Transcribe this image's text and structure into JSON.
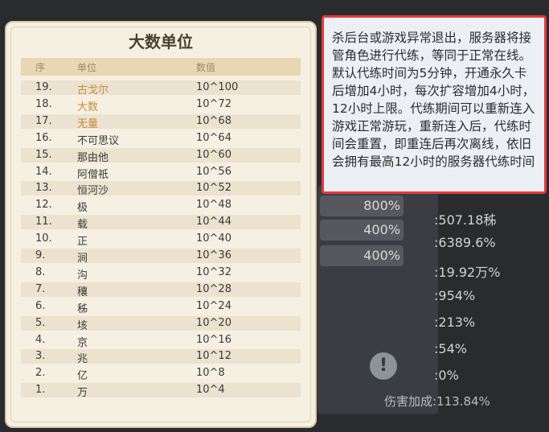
{
  "background": {
    "percents": [
      "800%",
      "400%",
      "400%"
    ],
    "stats": [
      ":507.18秭",
      ":6389.6%",
      ":19.92万%",
      ":954%",
      ":213%",
      ":54%",
      ":0%"
    ],
    "bottom_stat": "伤害加成:113.84%"
  },
  "units_table": {
    "title": "大数单位",
    "headers": {
      "idx": "序",
      "name": "单位",
      "value": "数值"
    },
    "rows": [
      {
        "idx": "19.",
        "name": "古戈尔",
        "value": "10^100",
        "highlight": true
      },
      {
        "idx": "18.",
        "name": "大数",
        "value": "10^72",
        "highlight": true
      },
      {
        "idx": "17.",
        "name": "无量",
        "value": "10^68",
        "highlight": true
      },
      {
        "idx": "16.",
        "name": "不可思议",
        "value": "10^64",
        "highlight": false
      },
      {
        "idx": "15.",
        "name": "那由他",
        "value": "10^60",
        "highlight": false
      },
      {
        "idx": "14.",
        "name": "阿僧祇",
        "value": "10^56",
        "highlight": false
      },
      {
        "idx": "13.",
        "name": "恒河沙",
        "value": "10^52",
        "highlight": false
      },
      {
        "idx": "12.",
        "name": "极",
        "value": "10^48",
        "highlight": false
      },
      {
        "idx": "11.",
        "name": "载",
        "value": "10^44",
        "highlight": false
      },
      {
        "idx": "10.",
        "name": "正",
        "value": "10^40",
        "highlight": false
      },
      {
        "idx": "9.",
        "name": "涧",
        "value": "10^36",
        "highlight": false
      },
      {
        "idx": "8.",
        "name": "沟",
        "value": "10^32",
        "highlight": false
      },
      {
        "idx": "7.",
        "name": "穰",
        "value": "10^28",
        "highlight": false
      },
      {
        "idx": "6.",
        "name": "秭",
        "value": "10^24",
        "highlight": false
      },
      {
        "idx": "5.",
        "name": "垓",
        "value": "10^20",
        "highlight": false
      },
      {
        "idx": "4.",
        "name": "京",
        "value": "10^16",
        "highlight": false
      },
      {
        "idx": "3.",
        "name": "兆",
        "value": "10^12",
        "highlight": false
      },
      {
        "idx": "2.",
        "name": "亿",
        "value": "10^8",
        "highlight": false
      },
      {
        "idx": "1.",
        "name": "万",
        "value": "10^4",
        "highlight": false
      }
    ]
  },
  "tooltip": {
    "text": "杀后台或游戏异常退出，服务器将接管角色进行代练，等同于正常在线。默认代练时间为5分钟，开通永久卡后增加4小时，每次扩容增加4小时，12小时上限。代练期间可以重新连入游戏正常游玩，重新连入后，代练时间会重置，即重连后再次离线，依旧会拥有最高12小时的服务器代练时间",
    "border_color": "#e23b3b"
  }
}
